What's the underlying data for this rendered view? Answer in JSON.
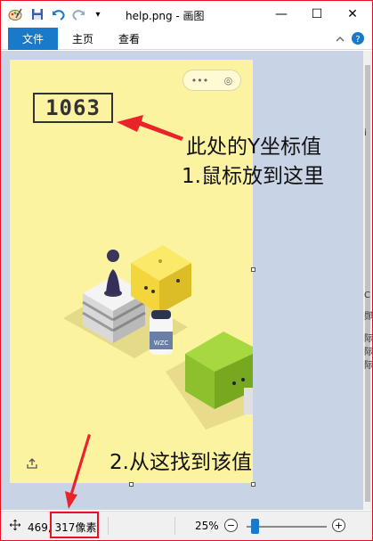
{
  "window": {
    "title": "help.png - 画图",
    "controls": {
      "minimize": "—",
      "maximize": "☐",
      "close": "✕"
    },
    "quick_access": [
      "paint-app-icon",
      "save-icon",
      "undo-icon",
      "redo-icon",
      "customize-dropdown-icon"
    ]
  },
  "ribbon": {
    "tabs": [
      {
        "label": "文件",
        "active": true
      },
      {
        "label": "主页",
        "active": false
      },
      {
        "label": "查看",
        "active": false
      }
    ],
    "collapse_icon": "chevron-up-icon",
    "help_icon": "help-icon"
  },
  "image": {
    "score": "1063",
    "capsule": {
      "more": "•••",
      "target": "◎"
    },
    "box_label": "WZC",
    "share_icon": "share-icon"
  },
  "annotations": {
    "line1": "此处的Y坐标值",
    "line2": "1.鼠标放到这里",
    "line3": "2.从这找到该值",
    "arrow_color": "#e8232a"
  },
  "behind_window": {
    "chars": [
      "i",
      "C",
      "郧",
      "际",
      "际",
      "际"
    ]
  },
  "status": {
    "coords": "469, 317像素",
    "zoom": "25%",
    "zoom_fraction": 0.25,
    "zoom_minus": "−",
    "zoom_plus": "+"
  },
  "colors": {
    "file_tab": "#1979ca",
    "canvas_bg": "#c8d4e6",
    "image_bg": "#fcf3a0",
    "highlight": "#e81123"
  }
}
